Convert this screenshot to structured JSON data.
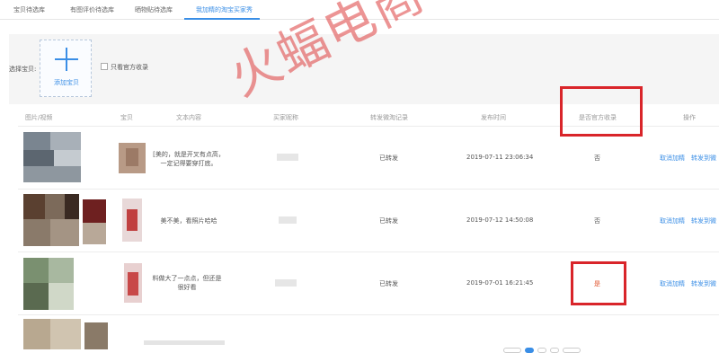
{
  "tabs": [
    {
      "label": "宝贝待选库",
      "active": false
    },
    {
      "label": "有图评价待选库",
      "active": false
    },
    {
      "label": "晒物贴待选库",
      "active": false
    },
    {
      "label": "我加精的淘宝买家秀",
      "active": true
    }
  ],
  "filter": {
    "select_label": "选择宝贝:",
    "add_item_label": "添加宝贝",
    "official_only_label": "只看官方收录",
    "official_only_checked": false
  },
  "table": {
    "headers": [
      "图片/视频",
      "宝贝",
      "文本内容",
      "买家昵称",
      "转发微淘记录",
      "发布时间",
      "是否官方收录",
      "操作"
    ],
    "rows": [
      {
        "text": "[美的，就是开叉有点高，一定记得要穿打底。",
        "forward": "已转发",
        "time": "2019-07-11 23:06:34",
        "official": "否"
      },
      {
        "text": "美不美，看照片哈哈",
        "forward": "已转发",
        "time": "2019-07-12 14:50:08",
        "official": "否"
      },
      {
        "text": "料做大了一点点，但还是很好看",
        "forward": "已转发",
        "time": "2019-07-01 16:21:45",
        "official": "是"
      }
    ],
    "actions": {
      "cancel": "取消加精",
      "forward": "转发到微"
    }
  },
  "watermark": "火蝠电商",
  "colors": {
    "accent": "#3a8ee6",
    "highlight_box": "#d9252a",
    "official_yes": "#e0542e"
  }
}
